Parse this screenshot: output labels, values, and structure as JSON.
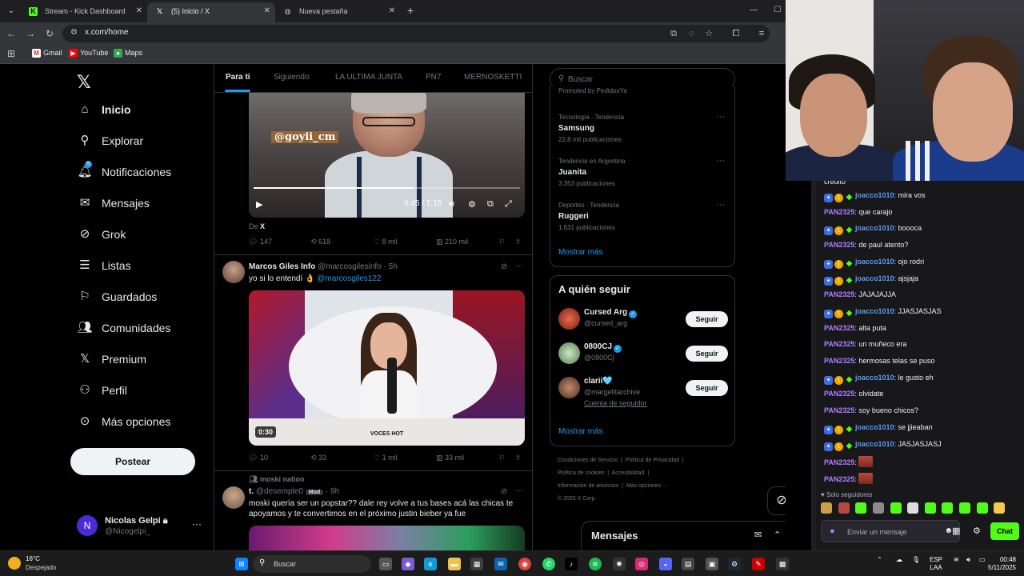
{
  "browser": {
    "tabs": [
      {
        "title": "Stream - Kick Dashboard",
        "icon": "kick-icon",
        "active": false
      },
      {
        "title": "(5) Inicio / X",
        "icon": "x-icon",
        "active": true
      },
      {
        "title": "Nueva pestaña",
        "icon": "globe-icon",
        "active": false
      }
    ],
    "url": "x.com/home",
    "bookmarks": [
      "Gmail",
      "YouTube",
      "Maps"
    ]
  },
  "x": {
    "nav": [
      {
        "label": "Inicio",
        "icon": "home-icon"
      },
      {
        "label": "Explorar",
        "icon": "search-icon"
      },
      {
        "label": "Notificaciones",
        "icon": "bell-icon"
      },
      {
        "label": "Mensajes",
        "icon": "mail-icon"
      },
      {
        "label": "Grok",
        "icon": "grok-icon"
      },
      {
        "label": "Listas",
        "icon": "list-icon"
      },
      {
        "label": "Guardados",
        "icon": "bookmark-icon"
      },
      {
        "label": "Comunidades",
        "icon": "people-icon"
      },
      {
        "label": "Premium",
        "icon": "x-icon"
      },
      {
        "label": "Perfil",
        "icon": "person-icon"
      },
      {
        "label": "Más opciones",
        "icon": "more-circle-icon"
      }
    ],
    "notif_count": "5",
    "post_label": "Postear",
    "account": {
      "name": "Nicolas Gelpi",
      "handle": "@Nicogelpi_",
      "initial": "N"
    },
    "timeline_tabs": [
      "Para ti",
      "Siguiendo",
      "LA ULTIMA JUNTA",
      "PN7",
      "MERNOSKETTI"
    ],
    "tweet1": {
      "video_tag": "@goyii_cm",
      "time": "0:45 / 1:15",
      "progress": 0.6,
      "source_prefix": "De",
      "source_name": "X",
      "replies": "147",
      "reposts": "618",
      "likes": "8 mil",
      "views": "210 mil"
    },
    "tweet2": {
      "name": "Marcos Giles Info",
      "handle": "@marcosgilesinfo · 5h",
      "text": "yo si lo entendí 👌",
      "mention": "@marcosgiles122",
      "duration": "0:30",
      "caption": "VOCES HOT",
      "replies": "10",
      "reposts": "33",
      "likes": "1 mil",
      "views": "33 mil"
    },
    "tweet3": {
      "context": "moski nation",
      "name": "t.",
      "handle": "@desemple0",
      "role": "Mod",
      "time": "· 9h",
      "text": "moski quería ser un popstar?? dale rey volve a tus bases acá las chicas te apoyamos y te convertimos en el próximo justin bieber ya fue"
    },
    "search_placeholder": "Buscar",
    "promoted": "Promoted by PedidosYa",
    "trends": [
      {
        "category": "Tecnología · Tendencia",
        "title": "Samsung",
        "count": "22,8 mil publicaciones"
      },
      {
        "category": "Tendencia en Argentina",
        "title": "Juanita",
        "count": "3.353 publicaciones"
      },
      {
        "category": "Deportes · Tendencia",
        "title": "Ruggeri",
        "count": "1.631 publicaciones"
      }
    ],
    "show_more": "Mostrar más",
    "who_to_follow_title": "A quién seguir",
    "follow_label": "Seguir",
    "who_to_follow": [
      {
        "name": "Cursed Arg",
        "handle": "@cursed_arg",
        "verified": true
      },
      {
        "name": "0800CJ",
        "handle": "@0800Cj",
        "verified": true
      },
      {
        "name": "clarii🩵",
        "handle": "@margelitarchive",
        "verified": false,
        "sub": "Cuenta de seguidor"
      }
    ],
    "footer": [
      "Condiciones de Servicio",
      "Política de Privacidad",
      "Política de cookies",
      "Accesibilidad",
      "Información de anuncios",
      "Más opciones ···",
      "© 2025 X Corp."
    ],
    "messages_title": "Mensajes"
  },
  "chat": {
    "top_fragment": "credito",
    "messages": [
      {
        "user": "joacco1010",
        "text": ": mira vos",
        "badges": true
      },
      {
        "user": "PAN2325",
        "text": ": que carajo",
        "badges": false
      },
      {
        "user": "joacco1010",
        "text": ": boooca",
        "badges": true
      },
      {
        "user": "PAN2325",
        "text": ": de paul atento?",
        "badges": false
      },
      {
        "user": "joacco1010",
        "text": ": ojo rodri",
        "badges": true
      },
      {
        "user": "joacco1010",
        "text": ": ajsjaja",
        "badges": true
      },
      {
        "user": "PAN2325",
        "text": ": JAJAJAJJA",
        "badges": false
      },
      {
        "user": "joacco1010",
        "text": ": JJASJASJAS",
        "badges": true
      },
      {
        "user": "PAN2325",
        "text": ": alta puta",
        "badges": false
      },
      {
        "user": "PAN2325",
        "text": ": un muñeco era",
        "badges": false
      },
      {
        "user": "PAN2325",
        "text": ": hermosas telas se puso",
        "badges": false
      },
      {
        "user": "joacco1010",
        "text": ": le gusto eh",
        "badges": true
      },
      {
        "user": "PAN2325",
        "text": ": olvidate",
        "badges": false
      },
      {
        "user": "PAN2325",
        "text": ": soy bueno chicos?",
        "badges": false
      },
      {
        "user": "joacco1010",
        "text": ": se jjieaban",
        "badges": true
      },
      {
        "user": "joacco1010",
        "text": ": JASJASJASJ",
        "badges": true
      },
      {
        "user": "PAN2325",
        "text": ":",
        "badges": false,
        "emote": true
      },
      {
        "user": "PAN2325",
        "text": ":",
        "badges": false,
        "emote": true
      }
    ],
    "mode": "Solo seguidores",
    "input_placeholder": "Enviar un mensaje",
    "send_label": "Chat"
  },
  "taskbar": {
    "temp": "16°C",
    "weather": "Despejado",
    "search": "Buscar",
    "lang": "ESP",
    "region": "LAA",
    "time": "00:48",
    "date": "5/11/2025"
  },
  "colors": {
    "x_blue": "#1d9bf0",
    "kick_green": "#53fc18",
    "chat_user_blue": "#5b9bf7",
    "chat_user_purple": "#b07cff"
  }
}
